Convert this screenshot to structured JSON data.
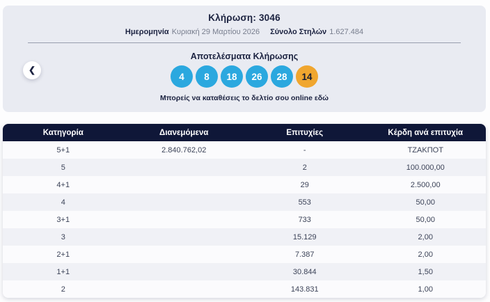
{
  "draw": {
    "title": "Κλήρωση: 3046",
    "date_label": "Ημερομηνία",
    "date_value": "Κυριακή 29 Μαρτίου 2026",
    "total_columns_label": "Σύνολο Στηλών",
    "total_columns_value": "1.627.484",
    "results_title": "Αποτελέσματα Κλήρωσης",
    "numbers": [
      "4",
      "8",
      "18",
      "26",
      "28"
    ],
    "bonus_number": "14",
    "online_text": "Μπορείς να καταθέσεις το δελτίο σου online εδώ",
    "prev_icon_glyph": "❮"
  },
  "colors": {
    "navy": "#0F1738",
    "card_bg": "#E9EBF2",
    "ball_blue": "#2BA8DF",
    "ball_bonus": "#F0A62F",
    "row_alt": "#F0F1F6"
  },
  "table": {
    "headers": [
      "Κατηγορία",
      "Διανεμόμενα",
      "Επιτυχίες",
      "Κέρδη ανά επιτυχία"
    ],
    "rows": [
      {
        "category": "5+1",
        "distributed": "2.840.762,02",
        "winners": "-",
        "prize": "ΤΖΑΚΠΟΤ"
      },
      {
        "category": "5",
        "distributed": "",
        "winners": "2",
        "prize": "100.000,00"
      },
      {
        "category": "4+1",
        "distributed": "",
        "winners": "29",
        "prize": "2.500,00"
      },
      {
        "category": "4",
        "distributed": "",
        "winners": "553",
        "prize": "50,00"
      },
      {
        "category": "3+1",
        "distributed": "",
        "winners": "733",
        "prize": "50,00"
      },
      {
        "category": "3",
        "distributed": "",
        "winners": "15.129",
        "prize": "2,00"
      },
      {
        "category": "2+1",
        "distributed": "",
        "winners": "7.387",
        "prize": "2,00"
      },
      {
        "category": "1+1",
        "distributed": "",
        "winners": "30.844",
        "prize": "1,50"
      },
      {
        "category": "2",
        "distributed": "",
        "winners": "143.831",
        "prize": "1,00"
      }
    ]
  }
}
